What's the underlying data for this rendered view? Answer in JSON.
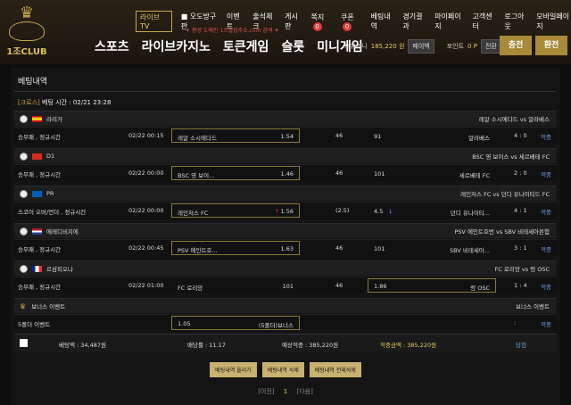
{
  "logo": {
    "name": "1조CLUB",
    "emblem_text": "ONE TRILLION CLUB"
  },
  "topnav": [
    {
      "label": "라이브 TV"
    },
    {
      "label": "오도방구판"
    },
    {
      "label": "이벤트"
    },
    {
      "label": "출석체크"
    },
    {
      "label": "게시판"
    },
    {
      "label": "쪽지",
      "badge": "0"
    },
    {
      "label": "쿠폰",
      "badge": "0"
    },
    {
      "label": "베팅내역"
    },
    {
      "label": "경기결과"
    },
    {
      "label": "마이페이지"
    },
    {
      "label": "고객센터"
    },
    {
      "label": "로그아웃"
    },
    {
      "label": "모바일페이지"
    }
  ],
  "domain_note": "✦ 평생 도메인 1조클럽주소.com 검색 ✦",
  "mainnav": [
    "스포츠",
    "라이브카지노",
    "토큰게임",
    "슬롯",
    "미니게임"
  ],
  "user": {
    "balance_label": "보유머니",
    "balance": "185,220 원",
    "change_btn": "페이백",
    "point_label": "포인트",
    "point": "0 P",
    "point_btn": "전환"
  },
  "header_buttons": {
    "deposit": "충전",
    "withdraw": "환전"
  },
  "page": {
    "title": "베팅내역",
    "slip_tag": "[크로스]",
    "slip_time": "베팅 시간 : 02/21 23:28"
  },
  "bets": [
    {
      "league": "라리가",
      "match": "레알 소시에다드 vs 알라베스",
      "market": "승무패 , 정규시간",
      "time": "02/22 00:15",
      "home": "레알 소시에다드",
      "home_odds": "1.54",
      "draw": "46",
      "away_val": "91",
      "away": "알라베스",
      "score": "4 : 0",
      "result": "적중"
    },
    {
      "league": "D1",
      "match": "BSC 영 보이스 vs 세르베테 FC",
      "market": "승무패 , 정규시간",
      "time": "02/22 00:00",
      "home": "BSC 영 보이...",
      "home_odds": "1.46",
      "draw": "46",
      "away_val": "101",
      "away": "세르베테 FC",
      "score": "2 : 0",
      "result": "적중"
    },
    {
      "league": "PR",
      "match": "레인저스 FC vs 던디 유나이티드 FC",
      "market": "스코어 오버/언더 , 정규시간",
      "time": "02/22 00:00",
      "home": "레인저스 FC",
      "home_odds": "1.56",
      "draw": "(2.5)",
      "away_val": "4.5",
      "away": "던디 유나이티...",
      "score": "4 : 1",
      "result": "적중"
    },
    {
      "league": "에레디비지에",
      "match": "PSV 에인트호번 vs SBV 비테세아른험",
      "market": "승무패 , 정규시간",
      "time": "02/22 00:45",
      "home": "PSV 에인트호...",
      "home_odds": "1.63",
      "draw": "46",
      "away_val": "101",
      "away": "SBV 비테세아...",
      "score": "3 : 1",
      "result": "적중"
    },
    {
      "league": "르샴피오나",
      "match": "FC 로리앙 vs 렁 OSC",
      "market": "승무패 , 정규시간",
      "time": "02/22 01:00",
      "home": "FC 로리앙",
      "home_odds": "101",
      "draw": "46",
      "away_val": "1.86",
      "away": "렁 OSC",
      "score": "1 : 4",
      "result": "적중"
    },
    {
      "league": "보너스 이벤트",
      "match": "보너스 이벤트",
      "market": "5폴더 이벤트",
      "time": "",
      "home": "1.05",
      "home_odds": "(5폴더)보너스",
      "draw": "",
      "away_val": "",
      "away": "",
      "score": ":",
      "result": "적중"
    }
  ],
  "summary": {
    "bet_amount": "베팅액 : 34,487원",
    "odds": "배당률 : 11.17",
    "expected": "예상적중 : 385,220원",
    "win_amount": "적중금액 : 385,220원",
    "status": "당첨"
  },
  "actions": [
    "베팅내역 올리기",
    "베팅내역 삭제",
    "베팅내역 전체삭제"
  ],
  "pager": {
    "prev": "[이전]",
    "current": "1",
    "next": "[다음]"
  },
  "colors": {
    "accent": "#c9a54a",
    "win": "#6aa0e0",
    "danger": "#e04040"
  }
}
